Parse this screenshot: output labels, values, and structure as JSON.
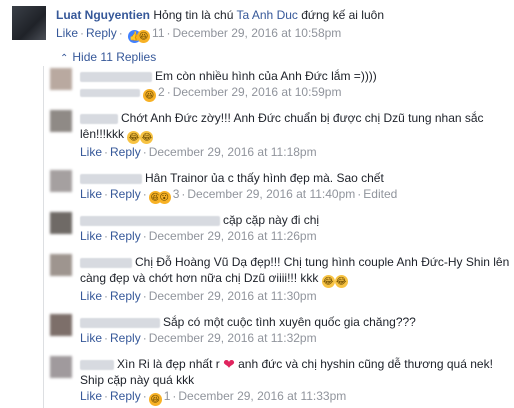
{
  "top_comment": {
    "author": "Luat Nguyentien",
    "text_before": " Hỏng tin là chú ",
    "tag": "Ta Anh Duc",
    "text_after": " đứng kế ai luôn",
    "like": "Like",
    "reply": "Reply",
    "reaction_count": "11",
    "date": "December 29, 2016 at 10:58pm"
  },
  "hide_replies_label": "Hide 11 Replies",
  "replies": [
    {
      "text": "Em còn nhiều hình của Anh Đức lắm =))))",
      "like": "Like",
      "reply": "Reply",
      "reaction_count": "2",
      "date": "December 29, 2016 at 10:59pm"
    },
    {
      "text": "Chớt Anh Đức zờy!!! Anh Đức chuẩn bị được chị Dzũ tung nhan sắc lên!!!kkk",
      "like": "Like",
      "reply": "Reply",
      "date": "December 29, 2016 at 11:18pm"
    },
    {
      "text": "Hân Trainor ủa c thấy hình đẹp mà. Sao chết",
      "like": "Like",
      "reply": "Reply",
      "reaction_count": "3",
      "date": "December 29, 2016 at 11:40pm",
      "edited": "Edited"
    },
    {
      "text": "cặp cặp này đi chị",
      "like": "Like",
      "reply": "Reply",
      "date": "December 29, 2016 at 11:26pm"
    },
    {
      "text": "Chị Đỗ Hoàng Vũ Dạ đẹp!!! Chị tung hình couple Anh Đức-Hy Shin lên càng đẹp và chớt hơn nữa chị Dzũ ơiiii!!! kkk",
      "like": "Like",
      "reply": "Reply",
      "date": "December 29, 2016 at 11:30pm"
    },
    {
      "text": "Sắp có một cuộc tình xuyên quốc gia chăng???",
      "like": "Like",
      "reply": "Reply",
      "date": "December 29, 2016 at 11:32pm"
    },
    {
      "text_before": "Xìn Ri là đẹp nhất r ",
      "text_after": " anh đức và chị hyshin cũng dễ thương quá nek! Ship cặp này quá kkk",
      "like": "Like",
      "reply": "Reply",
      "reaction_count": "1",
      "date": "December 29, 2016 at 11:33pm"
    }
  ],
  "colors": {
    "link": "#365899",
    "meta": "#90949c",
    "like_reaction": "#4080ff",
    "haha_reaction": "#f7b125",
    "heart": "#e0245e"
  }
}
